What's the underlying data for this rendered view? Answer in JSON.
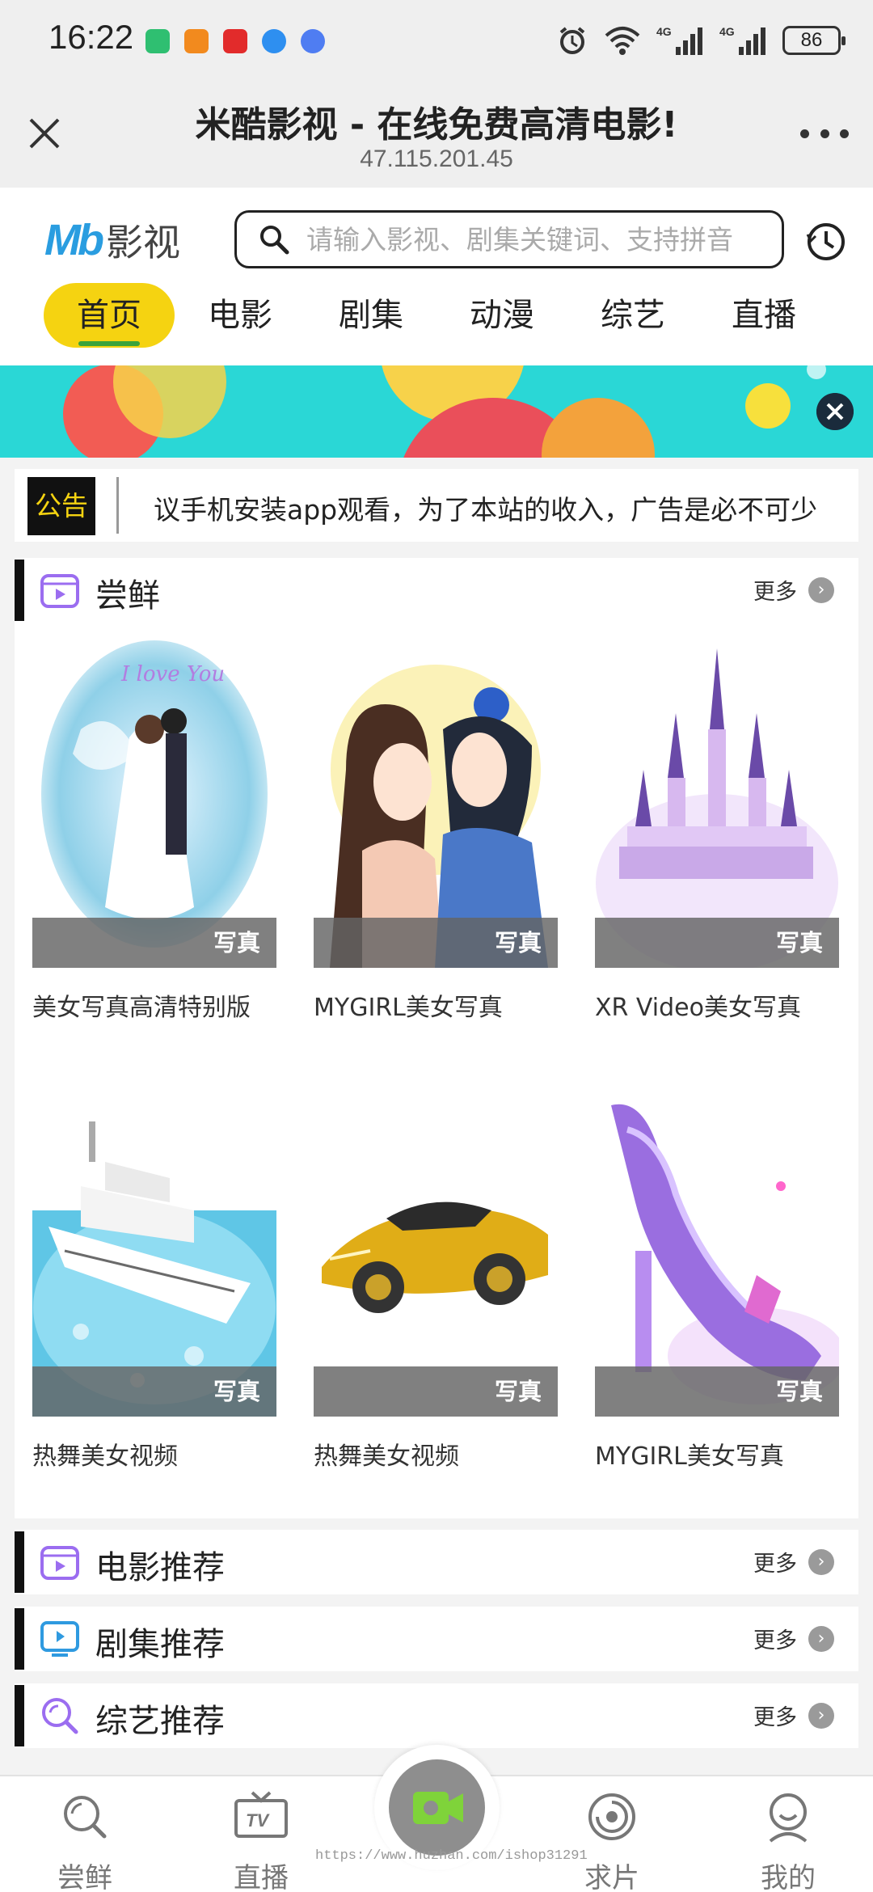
{
  "status_bar": {
    "time": "16:22",
    "battery": "86",
    "network": "4G"
  },
  "browser": {
    "title": "米酷影视 - 在线免费高清电影!",
    "url": "47.115.201.45"
  },
  "header": {
    "logo_mark": "Mb",
    "logo_text": "影视",
    "search_placeholder": "请输入影视、剧集关键词、支持拼音"
  },
  "nav_tabs": [
    {
      "label": "首页",
      "active": true
    },
    {
      "label": "电影"
    },
    {
      "label": "剧集"
    },
    {
      "label": "动漫"
    },
    {
      "label": "综艺"
    },
    {
      "label": "直播"
    }
  ],
  "notice": {
    "tag": "公告",
    "text": "议手机安装app观看，为了本站的收入，广告是必不可少"
  },
  "section_main": {
    "title": "尝鲜",
    "more": "更多",
    "items": [
      {
        "title": "美女写真高清特别版",
        "tag": "写真"
      },
      {
        "title": "MYGIRL美女写真",
        "tag": "写真"
      },
      {
        "title": "XR Video美女写真",
        "tag": "写真"
      },
      {
        "title": "热舞美女视频",
        "tag": "写真"
      },
      {
        "title": "热舞美女视频",
        "tag": "写真"
      },
      {
        "title": "MYGIRL美女写真",
        "tag": "写真"
      }
    ]
  },
  "categories": [
    {
      "title": "电影推荐",
      "more": "更多"
    },
    {
      "title": "剧集推荐",
      "more": "更多"
    },
    {
      "title": "综艺推荐",
      "more": "更多"
    }
  ],
  "bottom_nav": [
    {
      "label": "尝鲜",
      "icon": "search-icon"
    },
    {
      "label": "直播",
      "icon": "tv-icon"
    },
    {
      "label": "",
      "icon": "video-camera-icon"
    },
    {
      "label": "求片",
      "icon": "target-icon"
    },
    {
      "label": "我的",
      "icon": "user-icon"
    }
  ],
  "watermark": "https://www.huzhan.com/ishop31291",
  "colors": {
    "accent": "#f5d311",
    "active_underline": "#3aa33a",
    "banner": "#2ad7d6"
  }
}
